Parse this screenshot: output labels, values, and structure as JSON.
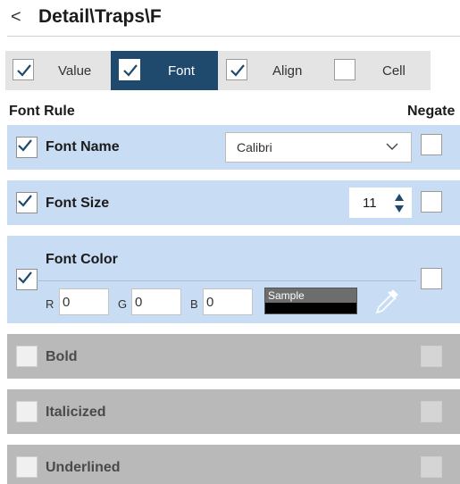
{
  "header": {
    "back_glyph": "<",
    "title": "Detail\\Traps\\F"
  },
  "tabs": [
    {
      "label": "Value",
      "checked": true,
      "active": false
    },
    {
      "label": "Font",
      "checked": true,
      "active": true
    },
    {
      "label": "Align",
      "checked": true,
      "active": false
    },
    {
      "label": "Cell",
      "checked": false,
      "active": false
    }
  ],
  "section": {
    "left_label": "Font Rule",
    "right_label": "Negate"
  },
  "rules": {
    "font_name": {
      "label": "Font Name",
      "checked": true,
      "negate": false,
      "value": "Calibri"
    },
    "font_size": {
      "label": "Font Size",
      "checked": true,
      "negate": false,
      "value": "11"
    },
    "font_color": {
      "label": "Font Color",
      "checked": true,
      "negate": false,
      "r_label": "R",
      "r_value": "0",
      "g_label": "G",
      "g_value": "0",
      "b_label": "B",
      "b_value": "0",
      "sample_label": "Sample"
    },
    "bold": {
      "label": "Bold",
      "checked": false,
      "negate": false,
      "enabled": false
    },
    "italic": {
      "label": "Italicized",
      "checked": false,
      "negate": false,
      "enabled": false
    },
    "underline": {
      "label": "Underlined",
      "checked": false,
      "negate": false,
      "enabled": false
    }
  },
  "colors": {
    "active_tab": "#1f4a6e",
    "rule_row": "#c8dcf3",
    "disabled_row": "#b9b9b9",
    "check_blue": "#1f4a6e"
  }
}
